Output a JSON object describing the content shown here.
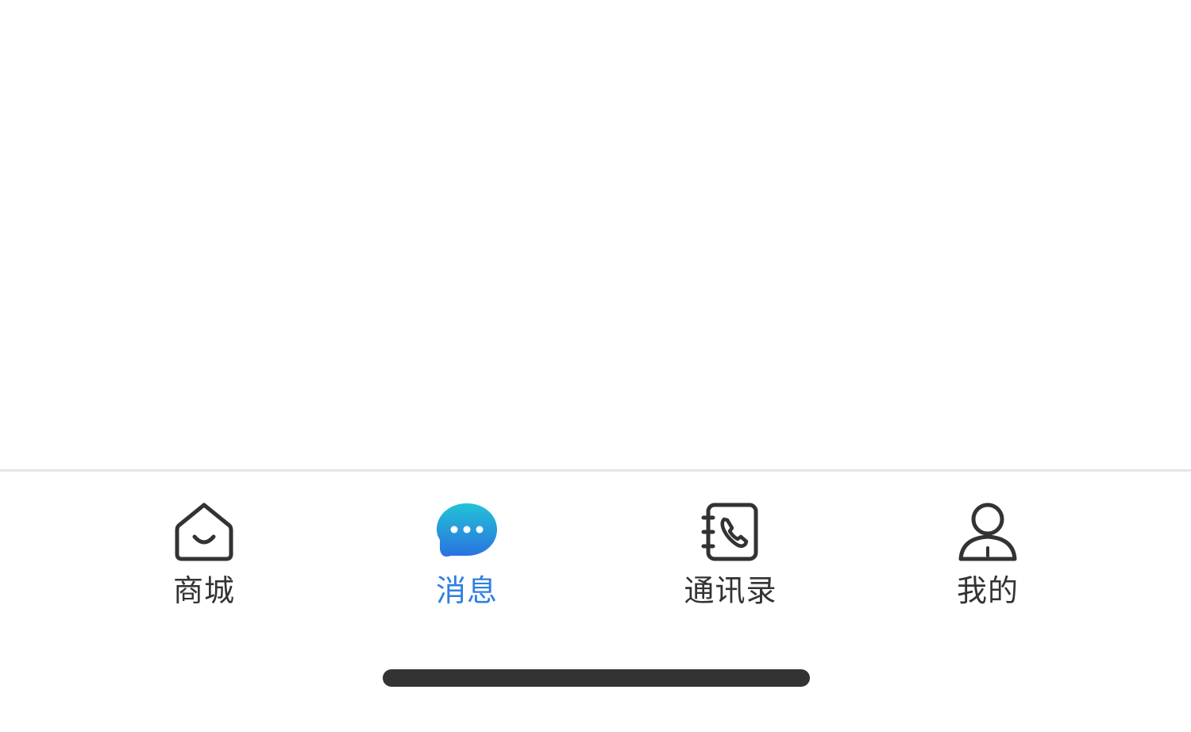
{
  "tabbar": {
    "items": [
      {
        "label": "商城",
        "icon": "store-home-icon",
        "active": false
      },
      {
        "label": "消息",
        "icon": "message-bubble-icon",
        "active": true
      },
      {
        "label": "通讯录",
        "icon": "contacts-phone-icon",
        "active": false
      },
      {
        "label": "我的",
        "icon": "profile-person-icon",
        "active": false
      }
    ],
    "active_color": "#2f7fe0",
    "inactive_color": "#333333"
  }
}
